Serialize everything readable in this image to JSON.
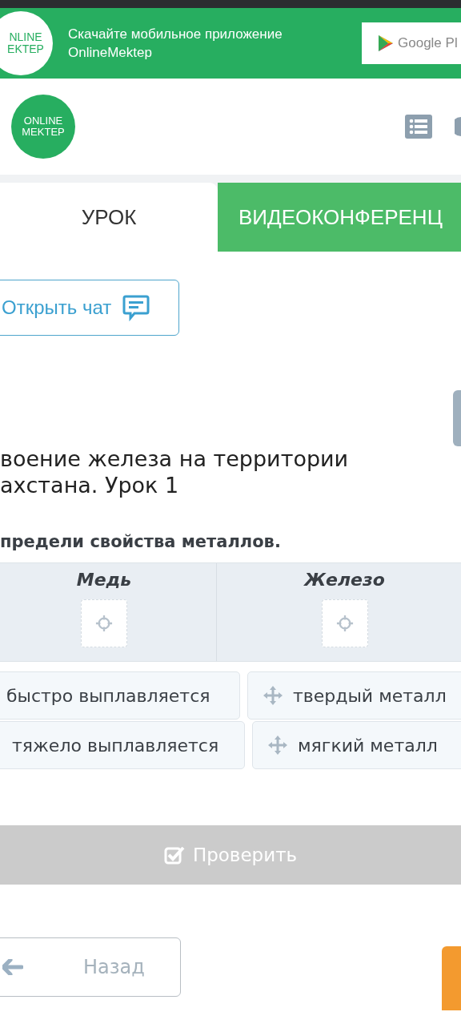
{
  "banner": {
    "logo_lines": [
      "NLINE",
      "EKTEP"
    ],
    "text_lines": [
      "Скачайте мобильное приложение",
      "OnlineMektep"
    ],
    "store_button": "Google Pl"
  },
  "header": {
    "logo_lines": [
      "ONLINE",
      "MEKTEP"
    ]
  },
  "tabs": [
    {
      "label": "УРОК",
      "selected": true
    },
    {
      "label": "ВИДЕОКОНФЕРЕНЦ",
      "selected": false
    }
  ],
  "chat_button": "Открыть чат",
  "lesson_title_lines": [
    "воение железа на территории",
    "ахстана. Урок 1"
  ],
  "task": {
    "question": "предели свойства металлов.",
    "columns": [
      {
        "heading": "Медь"
      },
      {
        "heading": "Железо"
      }
    ],
    "option_rows": [
      [
        {
          "text": "быстро выплавляется"
        },
        {
          "text": "твердый металл"
        }
      ],
      [
        {
          "text": "тяжело выплавляется"
        },
        {
          "text": "мягкий металл"
        }
      ]
    ]
  },
  "check_button": "Проверить",
  "back_button": "Назад"
}
